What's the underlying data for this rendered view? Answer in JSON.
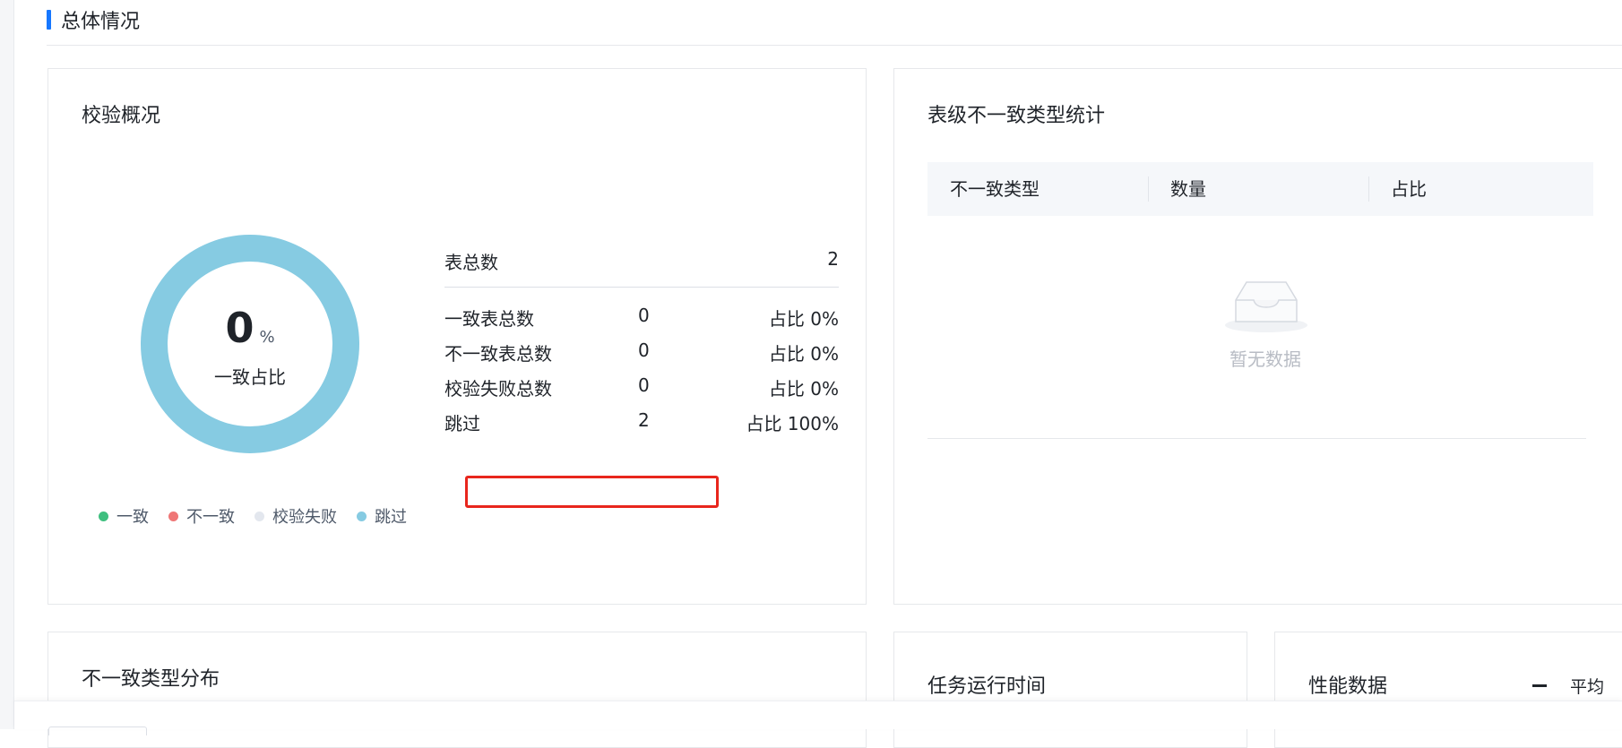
{
  "section": {
    "title": "总体情况"
  },
  "overview": {
    "title": "校验概况",
    "donut": {
      "value": "0",
      "unit": "%",
      "label": "一致占比"
    },
    "total": {
      "label": "表总数",
      "value": "2"
    },
    "rows": [
      {
        "label": "一致表总数",
        "value": "0",
        "pct": "占比 0%"
      },
      {
        "label": "不一致表总数",
        "value": "0",
        "pct": "占比 0%"
      },
      {
        "label": "校验失败总数",
        "value": "0",
        "pct": "占比 0%"
      },
      {
        "label": "跳过",
        "value": "2",
        "pct": "占比 100%"
      }
    ],
    "legend": [
      {
        "label": "一致",
        "color": "#3fbf7f"
      },
      {
        "label": "不一致",
        "color": "#ef7676"
      },
      {
        "label": "校验失败",
        "color": "#e3e7ee"
      },
      {
        "label": "跳过",
        "color": "#86cbe2"
      }
    ],
    "donut_colors": {
      "skip": "#86cbe2"
    }
  },
  "table_types": {
    "title": "表级不一致类型统计",
    "columns": [
      "不一致类型",
      "数量",
      "占比"
    ],
    "empty_text": "暂无数据"
  },
  "dist": {
    "title": "不一致类型分布"
  },
  "runtime": {
    "title": "任务运行时间"
  },
  "perf": {
    "title": "性能数据",
    "legend_label": "平均"
  }
}
